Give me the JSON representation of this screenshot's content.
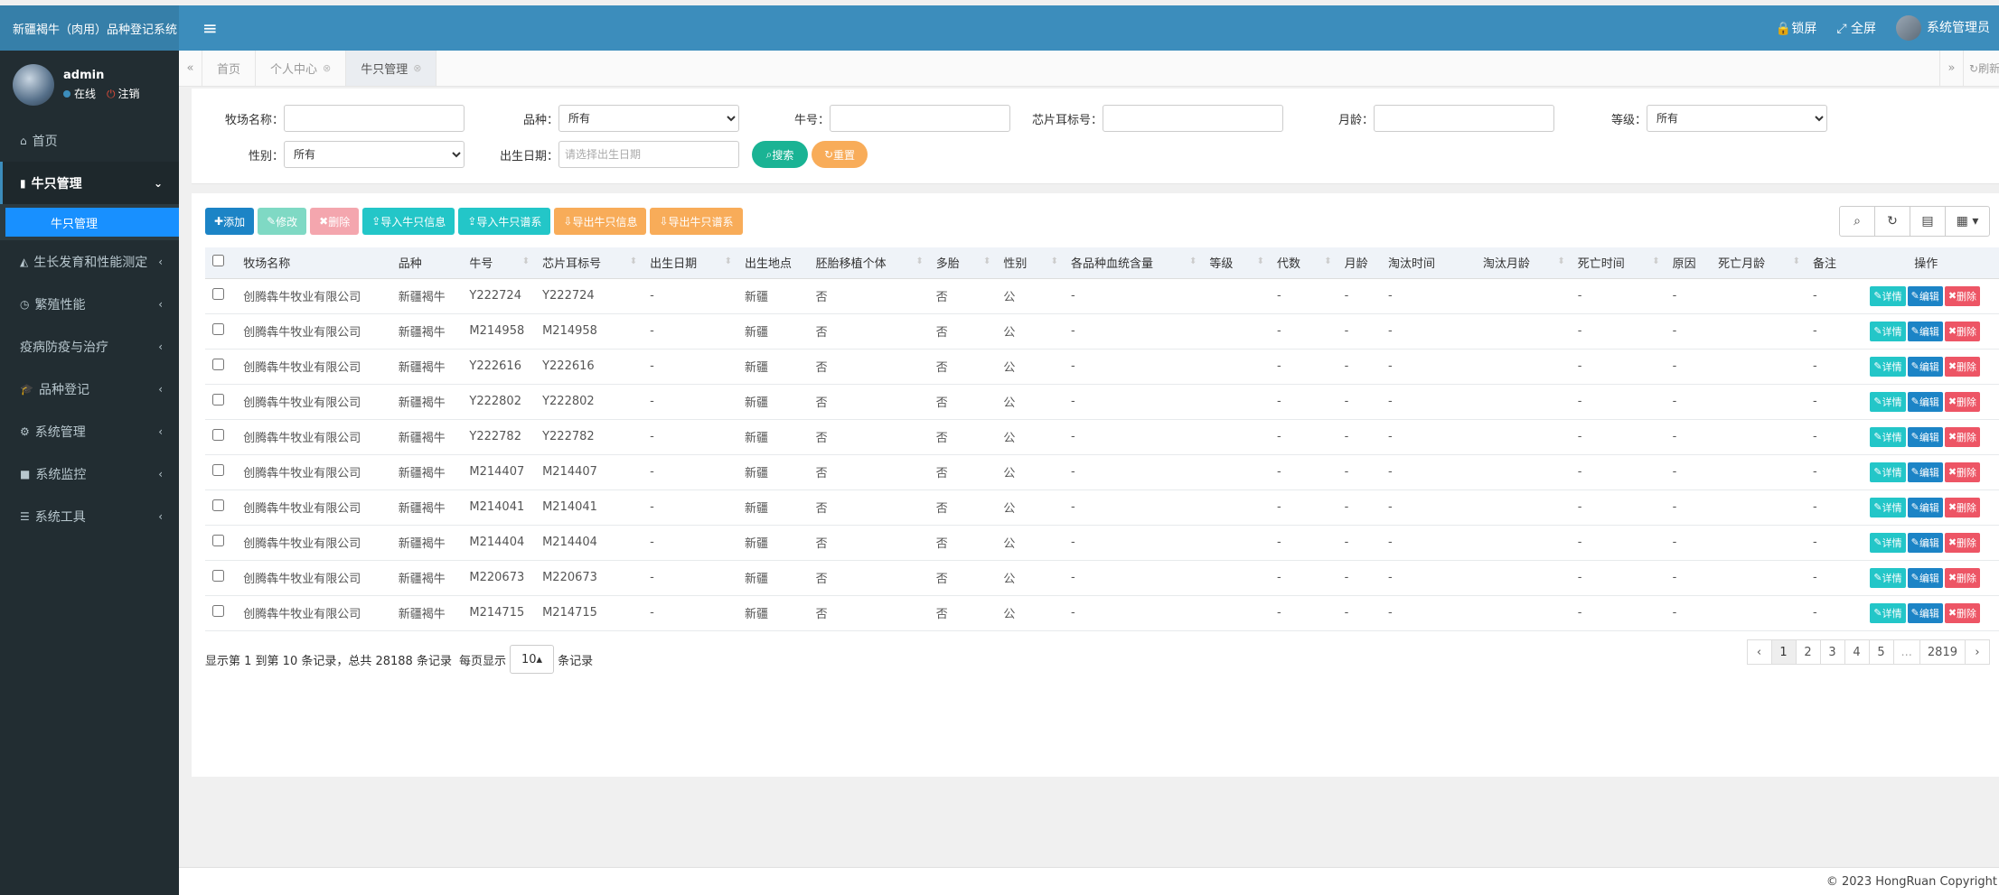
{
  "app": {
    "title": "新疆褐牛（肉用）品种登记系统"
  },
  "header": {
    "lock_label": "锁屏",
    "fullscreen_label": "全屏",
    "user_label": "系统管理员"
  },
  "user": {
    "name": "admin",
    "status": "在线",
    "logout": "注销"
  },
  "sidebar": {
    "items": [
      {
        "label": "首页",
        "icon": "home-icon"
      },
      {
        "label": "牛只管理",
        "icon": "map-icon",
        "active": true
      },
      {
        "label": "生长发育和性能测定",
        "icon": "area-chart-icon"
      },
      {
        "label": "繁殖性能",
        "icon": "clock-icon"
      },
      {
        "label": "疫病防疫与治疗",
        "icon": "none"
      },
      {
        "label": "品种登记",
        "icon": "graduation-cap-icon"
      },
      {
        "label": "系统管理",
        "icon": "gear-icon"
      },
      {
        "label": "系统监控",
        "icon": "video-camera-icon"
      },
      {
        "label": "系统工具",
        "icon": "bars-icon"
      }
    ],
    "sub_item": "牛只管理"
  },
  "tabs": [
    {
      "label": "首页",
      "closable": false
    },
    {
      "label": "个人中心",
      "closable": true
    },
    {
      "label": "牛只管理",
      "closable": true,
      "active": true
    }
  ],
  "tabbar": {
    "refresh_label": "刷新"
  },
  "search": {
    "farm_label": "牧场名称：",
    "farm_value": "",
    "breed_label": "品种：",
    "breed_value": "所有",
    "cow_no_label": "牛号：",
    "cow_no_value": "",
    "chip_label": "芯片耳标号：",
    "chip_value": "",
    "age_label": "月龄：",
    "age_value": "",
    "grade_label": "等级：",
    "grade_value": "所有",
    "sex_label": "性别：",
    "sex_value": "所有",
    "birth_label": "出生日期：",
    "birth_placeholder": "请选择出生日期",
    "search_btn": "搜索",
    "reset_btn": "重置"
  },
  "toolbar": {
    "add": "添加",
    "modify": "修改",
    "delete": "删除",
    "import_info": "导入牛只信息",
    "import_pedigree": "导入牛只谱系",
    "export_info": "导出牛只信息",
    "export_pedigree": "导出牛只谱系"
  },
  "table": {
    "columns": [
      "牧场名称",
      "品种",
      "牛号",
      "芯片耳标号",
      "出生日期",
      "出生地点",
      "胚胎移植个体",
      "多胎",
      "性别",
      "各品种血统含量",
      "等级",
      "代数",
      "月龄",
      "淘汰时间",
      "淘汰月龄",
      "死亡时间",
      "原因",
      "死亡月龄",
      "备注",
      "操作"
    ],
    "rows": [
      [
        "创腾犇牛牧业有限公司",
        "新疆褐牛",
        "Y222724",
        "Y222724",
        "-",
        "新疆",
        "否",
        "否",
        "公",
        "-",
        "",
        "-",
        "-",
        "-",
        "",
        "-",
        "-",
        "",
        "-"
      ],
      [
        "创腾犇牛牧业有限公司",
        "新疆褐牛",
        "M214958",
        "M214958",
        "-",
        "新疆",
        "否",
        "否",
        "公",
        "-",
        "",
        "-",
        "-",
        "-",
        "",
        "-",
        "-",
        "",
        "-"
      ],
      [
        "创腾犇牛牧业有限公司",
        "新疆褐牛",
        "Y222616",
        "Y222616",
        "-",
        "新疆",
        "否",
        "否",
        "公",
        "-",
        "",
        "-",
        "-",
        "-",
        "",
        "-",
        "-",
        "",
        "-"
      ],
      [
        "创腾犇牛牧业有限公司",
        "新疆褐牛",
        "Y222802",
        "Y222802",
        "-",
        "新疆",
        "否",
        "否",
        "公",
        "-",
        "",
        "-",
        "-",
        "-",
        "",
        "-",
        "-",
        "",
        "-"
      ],
      [
        "创腾犇牛牧业有限公司",
        "新疆褐牛",
        "Y222782",
        "Y222782",
        "-",
        "新疆",
        "否",
        "否",
        "公",
        "-",
        "",
        "-",
        "-",
        "-",
        "",
        "-",
        "-",
        "",
        "-"
      ],
      [
        "创腾犇牛牧业有限公司",
        "新疆褐牛",
        "M214407",
        "M214407",
        "-",
        "新疆",
        "否",
        "否",
        "公",
        "-",
        "",
        "-",
        "-",
        "-",
        "",
        "-",
        "-",
        "",
        "-"
      ],
      [
        "创腾犇牛牧业有限公司",
        "新疆褐牛",
        "M214041",
        "M214041",
        "-",
        "新疆",
        "否",
        "否",
        "公",
        "-",
        "",
        "-",
        "-",
        "-",
        "",
        "-",
        "-",
        "",
        "-"
      ],
      [
        "创腾犇牛牧业有限公司",
        "新疆褐牛",
        "M214404",
        "M214404",
        "-",
        "新疆",
        "否",
        "否",
        "公",
        "-",
        "",
        "-",
        "-",
        "-",
        "",
        "-",
        "-",
        "",
        "-"
      ],
      [
        "创腾犇牛牧业有限公司",
        "新疆褐牛",
        "M220673",
        "M220673",
        "-",
        "新疆",
        "否",
        "否",
        "公",
        "-",
        "",
        "-",
        "-",
        "-",
        "",
        "-",
        "-",
        "",
        "-"
      ],
      [
        "创腾犇牛牧业有限公司",
        "新疆褐牛",
        "M214715",
        "M214715",
        "-",
        "新疆",
        "否",
        "否",
        "公",
        "-",
        "",
        "-",
        "-",
        "-",
        "",
        "-",
        "-",
        "",
        "-"
      ]
    ],
    "actions": {
      "detail": "详情",
      "edit": "编辑",
      "delete": "删除"
    }
  },
  "pagination": {
    "info_prefix": "显示第 1 到第 10 条记录，总共 28188 条记录",
    "per_page_label": "每页显示",
    "page_size": "10",
    "per_page_suffix": "条记录",
    "prev": "‹",
    "next": "›",
    "pages": [
      "1",
      "2",
      "3",
      "4",
      "5",
      "...",
      "2819"
    ]
  },
  "footer": {
    "copyright": "© 2023 HongRuan Copyright"
  },
  "colors": {
    "header_bg": "#3c8dbc",
    "sidebar_bg": "#222d32",
    "active_sub": "#1890ff",
    "primary": "#1c84c6",
    "success": "#1ab394",
    "info": "#23c6c8",
    "warning": "#f8ac59",
    "danger": "#ed5565"
  }
}
